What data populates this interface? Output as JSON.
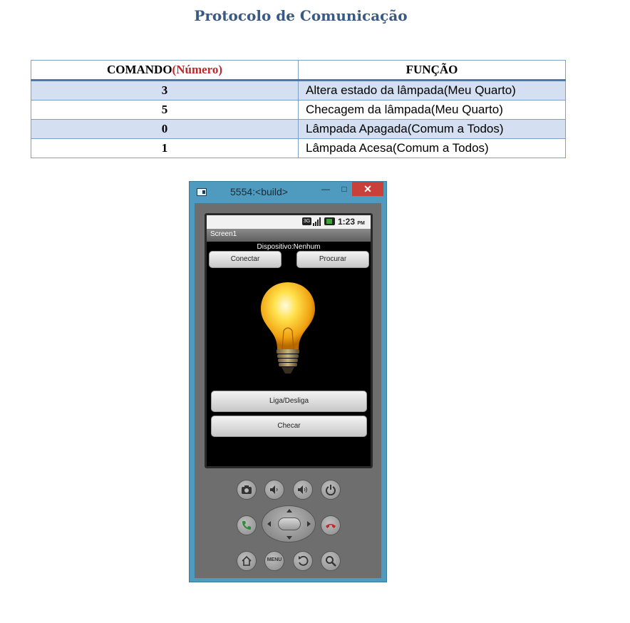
{
  "document": {
    "title": "Protocolo de Comunicação",
    "table": {
      "headers": {
        "comando": "COMANDO",
        "numero": "(Número)",
        "funcao": "FUNÇÃO"
      },
      "rows": [
        {
          "cmd": "3",
          "func": "Altera estado da lâmpada(Meu Quarto)"
        },
        {
          "cmd": "5",
          "func": "Checagem da lâmpada(Meu Quarto)"
        },
        {
          "cmd": "0",
          "func": "Lâmpada Apagada(Comum a Todos)"
        },
        {
          "cmd": "1",
          "func": "Lâmpada Acesa(Comum a Todos)"
        }
      ]
    }
  },
  "emulator": {
    "window_title": "5554:<build>",
    "window_buttons": {
      "minimize": "—",
      "maximize": "□",
      "close": "✕"
    },
    "status": {
      "network": "3G",
      "time": "1:23",
      "ampm": "PM"
    },
    "app": {
      "screen_title": "Screen1",
      "dispositivo": "Dispositivo:Nenhum",
      "conectar": "Conectar",
      "procurar": "Procurar",
      "liga_desliga": "Liga/Desliga",
      "checar": "Checar"
    },
    "hardware": {
      "menu_label": "MENU"
    },
    "colors": {
      "window": "#4f9bbf",
      "close": "#c9403a",
      "call": "#2e8b3a",
      "end": "#c0282a",
      "title": "#3a5a84"
    }
  }
}
